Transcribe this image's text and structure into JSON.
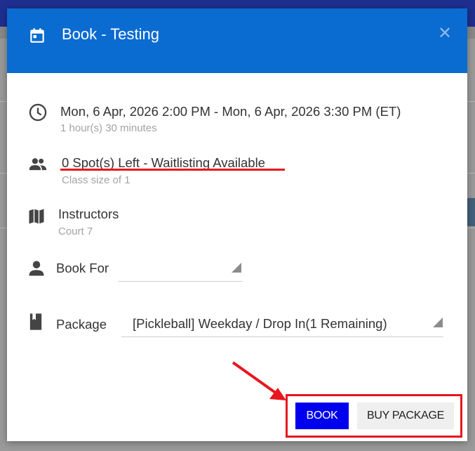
{
  "dialog": {
    "title": "Book - Testing",
    "close_icon": "close-icon",
    "header_icon": "calendar-icon"
  },
  "details": {
    "datetime": "Mon, 6 Apr, 2026 2:00 PM - Mon, 6 Apr, 2026 3:30 PM (ET)",
    "duration": "1 hour(s) 30 minutes",
    "spots": "0 Spot(s) Left - Waitlisting Available",
    "class_size": "Class size of 1",
    "instructors_label": "Instructors",
    "location": "Court 7"
  },
  "form": {
    "book_for_label": "Book For",
    "book_for_value": "",
    "package_label": "Package",
    "package_value": "[Pickleball] Weekday / Drop In(1 Remaining)"
  },
  "actions": {
    "book_label": "BOOK",
    "buy_package_label": "BUY PACKAGE"
  },
  "colors": {
    "header": "#0a6bd1",
    "book_button": "#0000ee",
    "annotation": "#e8161f"
  }
}
